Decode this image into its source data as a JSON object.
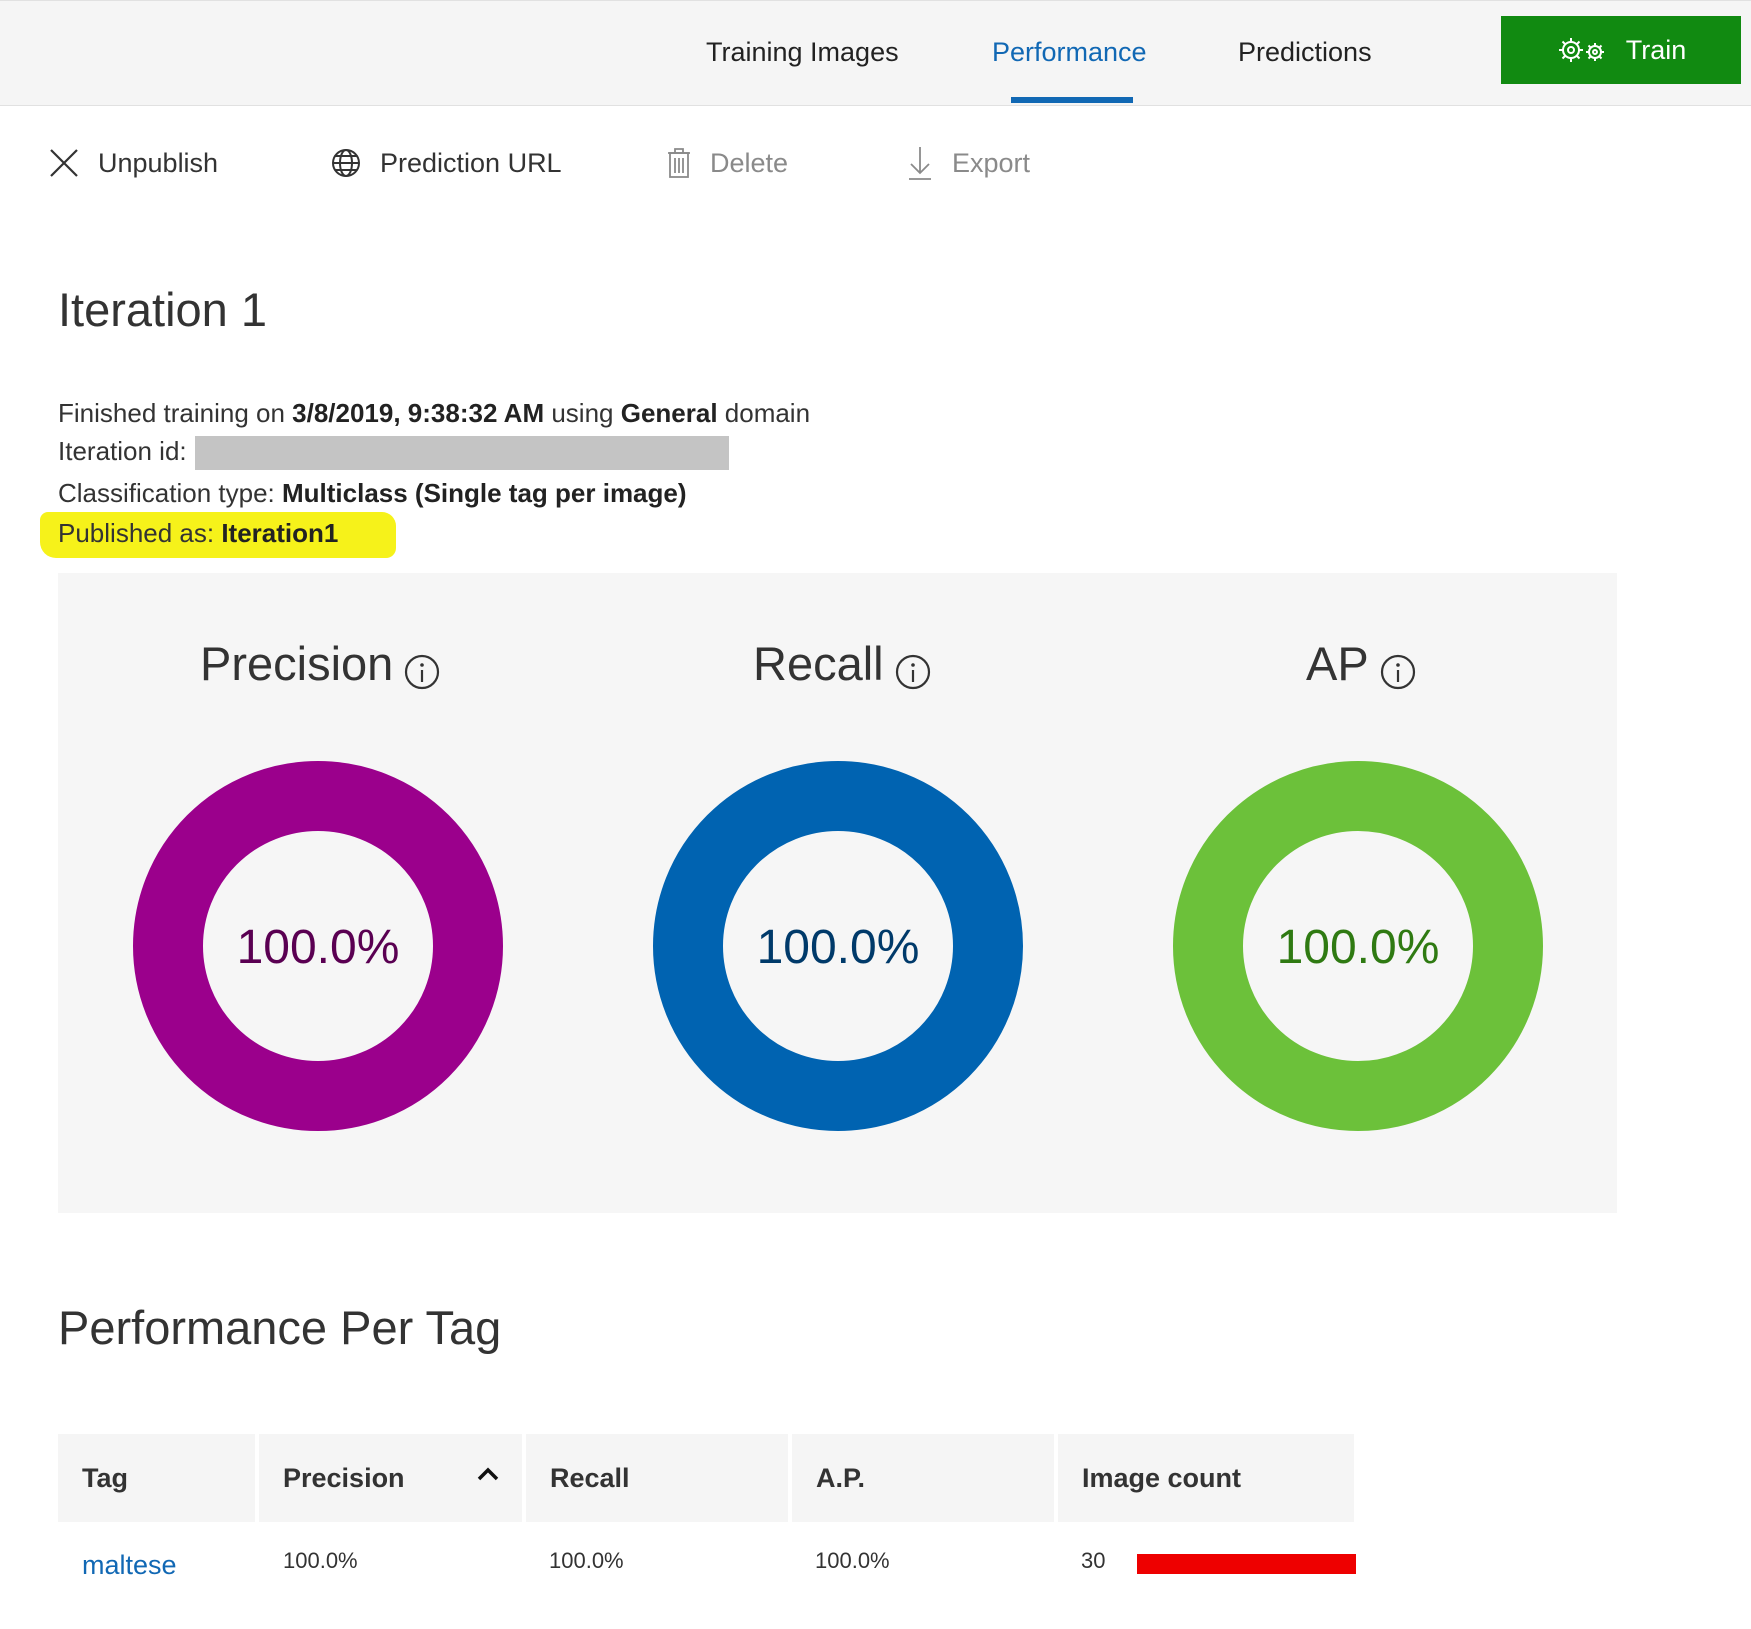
{
  "nav": {
    "tabs": [
      {
        "label": "Training Images"
      },
      {
        "label": "Performance",
        "active": true
      },
      {
        "label": "Predictions"
      }
    ],
    "train_label": "Train"
  },
  "commands": {
    "unpublish": "Unpublish",
    "prediction_url": "Prediction URL",
    "delete": "Delete",
    "export": "Export"
  },
  "iteration": {
    "title": "Iteration 1",
    "finished_prefix": "Finished training on ",
    "finished_date": "3/8/2019, 9:38:32 AM",
    "finished_mid": " using ",
    "domain": "General",
    "finished_suffix": " domain",
    "id_label": "Iteration id:",
    "classification_label": "Classification type: ",
    "classification_value": "Multiclass (Single tag per image)",
    "published_label": "Published as: ",
    "published_value": "Iteration1"
  },
  "metrics": [
    {
      "title": "Precision",
      "value": "100.0%",
      "fraction": 1.0,
      "ring_color": "#9b008c",
      "text_color": "#5a0052"
    },
    {
      "title": "Recall",
      "value": "100.0%",
      "fraction": 1.0,
      "ring_color": "#0063b1",
      "text_color": "#003a6a"
    },
    {
      "title": "AP",
      "value": "100.0%",
      "fraction": 1.0,
      "ring_color": "#6cc13a",
      "text_color": "#2f7a12"
    }
  ],
  "per_tag": {
    "title": "Performance Per Tag",
    "headers": {
      "tag": "Tag",
      "precision": "Precision",
      "recall": "Recall",
      "ap": "A.P.",
      "image_count": "Image count"
    },
    "sort_column": "precision",
    "rows": [
      {
        "tag": "maltese",
        "precision": "100.0%",
        "recall": "100.0%",
        "ap": "100.0%",
        "image_count": "30",
        "count_fraction": 1.0,
        "bar_color": "#ee0000"
      }
    ]
  },
  "colors": {
    "accent": "#1168b4",
    "train_button": "#118a11",
    "highlight": "#f6f21a"
  }
}
